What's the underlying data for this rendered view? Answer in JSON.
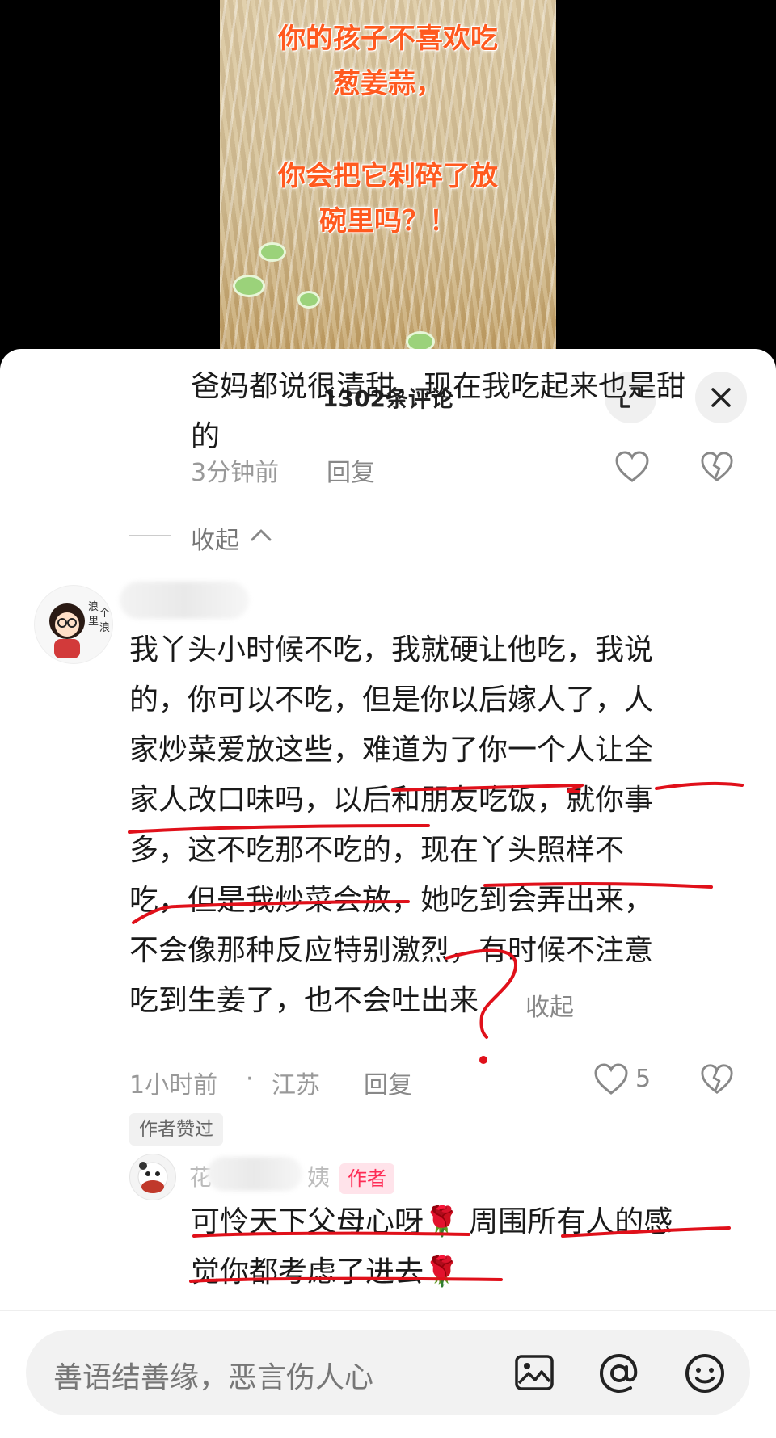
{
  "video": {
    "overlay_lines": [
      "你的孩子不喜欢吃",
      "葱姜蒜，",
      "你会把它剁碎了放",
      "碗里吗？！"
    ]
  },
  "sheet": {
    "title": "1302条评论"
  },
  "comments": [
    {
      "text_lines": [
        "爸妈都说很清甜，现在我吃起来也是甜",
        "的"
      ],
      "time": "3分钟前",
      "reply_label": "回复"
    },
    {
      "collapse_label": "收起",
      "avatar_text": "浪里个浪",
      "text_lines": [
        "我丫头小时候不吃，我就硬让他吃，我说",
        "的，你可以不吃，但是你以后嫁人了，人",
        "家炒菜爱放这些，难道为了你一个人让全",
        "家人改口味吗，以后和朋友吃饭，就你事",
        "多，这不吃那不吃的，现在丫头照样不",
        "吃，但是我炒菜会放，她吃到会弄出来，",
        "不会像那种反应特别激烈，有时候不注意",
        "吃到生姜了，也不会吐出来"
      ],
      "collapse_inline": "收起",
      "time": "1小时前",
      "dot": "·",
      "location": "江苏",
      "reply_label": "回复",
      "likes": "5",
      "liked_by_author": "作者赞过"
    },
    {
      "name_first": "花",
      "name_last": "姨",
      "badge": "作者",
      "text_lines": [
        "可怜天下父母心呀🌹 周围所有人的感",
        "觉你都考虑了进去🌹"
      ]
    }
  ],
  "input": {
    "placeholder": "善语结善缘，恶言伤人心"
  },
  "icons": [
    "expand-icon",
    "close-icon",
    "heart-icon",
    "broken-heart-icon",
    "chevron-up-icon",
    "image-icon",
    "at-icon",
    "emoji-icon"
  ],
  "colors": {
    "accent": "#fe2c55",
    "annotation": "#e0101a",
    "overlay_text": "#ff5a1f"
  }
}
